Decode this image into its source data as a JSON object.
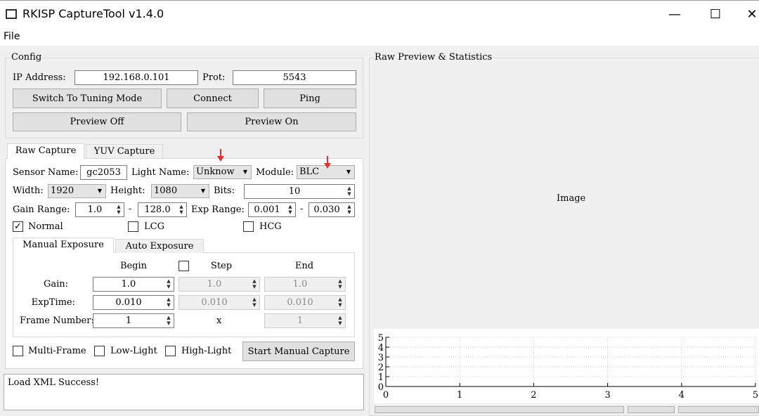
{
  "window": {
    "title": "RKISP CaptureTool v1.4.0",
    "minimize": "—",
    "maximize": "☐",
    "close": "✕"
  },
  "menu": {
    "file": "File"
  },
  "config": {
    "title": "Config",
    "ip_label": "IP Address:",
    "ip_value": "192.168.0.101",
    "port_label": "Prot:",
    "port_value": "5543",
    "switch_btn": "Switch To Tuning Mode",
    "connect_btn": "Connect",
    "ping_btn": "Ping",
    "preview_off_btn": "Preview Off",
    "preview_on_btn": "Preview On"
  },
  "tabs": {
    "raw": "Raw Capture",
    "yuv": "YUV Capture"
  },
  "raw": {
    "sensor_label": "Sensor Name:",
    "sensor_value": "gc2053",
    "light_label": "Light Name:",
    "light_value": "Unknow",
    "module_label": "Module:",
    "module_value": "BLC",
    "width_label": "Width:",
    "width_value": "1920",
    "height_label": "Height:",
    "height_value": "1080",
    "bits_label": "Bits:",
    "bits_value": "10",
    "gain_range_label": "Gain Range:",
    "gain_min": "1.0",
    "dash": "-",
    "gain_max": "128.0",
    "exp_range_label": "Exp Range:",
    "exp_min": "0.001",
    "exp_max": "0.030",
    "normal": "Normal",
    "normal_checked": true,
    "lcg": "LCG",
    "hcg": "HCG"
  },
  "exposure_tabs": {
    "manual": "Manual Exposure",
    "auto": "Auto Exposure"
  },
  "manual": {
    "begin": "Begin",
    "step": "Step",
    "end": "End",
    "gain_label": "Gain:",
    "gain_begin": "1.0",
    "gain_step": "1.0",
    "gain_end": "1.0",
    "exp_label": "ExpTime:",
    "exp_begin": "0.010",
    "exp_step": "0.010",
    "exp_end": "0.010",
    "frame_label": "Frame Number:",
    "frame_begin": "1",
    "frame_x": "x",
    "frame_end": "1"
  },
  "bottom": {
    "multi": "Multi-Frame",
    "low": "Low-Light",
    "high": "High-Light",
    "start_btn": "Start Manual Capture"
  },
  "log": {
    "text": "Load XML Success!"
  },
  "preview": {
    "title": "Raw Preview & Statistics",
    "image_label": "Image"
  },
  "chart_data": {
    "type": "line",
    "xlim": [
      0,
      5
    ],
    "ylim": [
      0,
      5
    ],
    "x_ticks": [
      "0",
      "1",
      "2",
      "3",
      "4",
      "5"
    ],
    "y_ticks": [
      "0",
      "1",
      "2",
      "3",
      "4",
      "5"
    ],
    "grid": true,
    "series": []
  }
}
